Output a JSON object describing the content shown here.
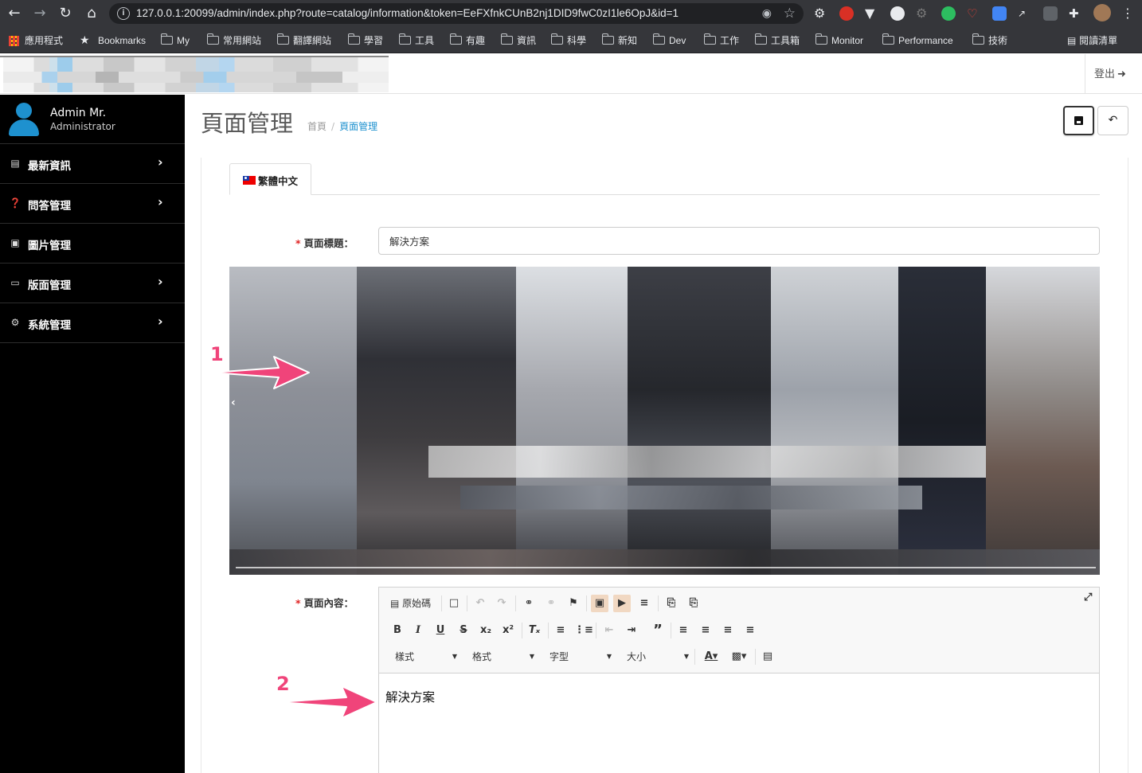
{
  "browser": {
    "url": "127.0.0.1:20099/admin/index.php?route=catalog/information&token=EeFXfnkCUnB2nj1DID9fwC0zI1le6OpJ&id=1",
    "bookmarks": [
      {
        "label": "應用程式",
        "icon": "apps-grid-icon"
      },
      {
        "label": "Bookmarks",
        "icon": "star-icon"
      },
      {
        "label": "My",
        "icon": "folder-icon"
      },
      {
        "label": "常用網站",
        "icon": "folder-icon"
      },
      {
        "label": "翻譯網站",
        "icon": "folder-icon"
      },
      {
        "label": "學習",
        "icon": "folder-icon"
      },
      {
        "label": "工具",
        "icon": "folder-icon"
      },
      {
        "label": "有趣",
        "icon": "folder-icon"
      },
      {
        "label": "資訊",
        "icon": "folder-icon"
      },
      {
        "label": "科學",
        "icon": "folder-icon"
      },
      {
        "label": "新知",
        "icon": "folder-icon"
      },
      {
        "label": "Dev",
        "icon": "folder-icon"
      },
      {
        "label": "工作",
        "icon": "folder-icon"
      },
      {
        "label": "工具箱",
        "icon": "folder-icon"
      },
      {
        "label": "Monitor",
        "icon": "folder-icon"
      },
      {
        "label": "Performance",
        "icon": "folder-icon"
      },
      {
        "label": "技術",
        "icon": "folder-icon"
      }
    ],
    "reading_list": "閱讀清單"
  },
  "header": {
    "logout_label": "登出"
  },
  "sidebar": {
    "user_name": "Admin Mr.",
    "user_role": "Administrator",
    "items": [
      {
        "label": "最新資訊",
        "icon": "newspaper-icon",
        "has_children": true
      },
      {
        "label": "問答管理",
        "icon": "question-circle-icon",
        "has_children": true
      },
      {
        "label": "圖片管理",
        "icon": "images-icon",
        "has_children": false
      },
      {
        "label": "版面管理",
        "icon": "desktop-icon",
        "has_children": true
      },
      {
        "label": "系統管理",
        "icon": "cog-icon",
        "has_children": true
      }
    ]
  },
  "main": {
    "title": "頁面管理",
    "breadcrumb": [
      "首頁",
      "頁面管理"
    ],
    "tab_language": "繁體中文",
    "field_title_label": "頁面標題：",
    "field_title_value": "解決方案",
    "field_content_label": "頁面內容：",
    "editor": {
      "source_label": "原始碼",
      "combos": [
        "樣式",
        "格式",
        "字型",
        "大小"
      ],
      "content_text": "解決方案"
    }
  },
  "annotations": [
    "1",
    "2"
  ],
  "colors": {
    "accent": "#1e91cf",
    "required": "#e02222",
    "annotation": "#f0447a",
    "sidebar_bg": "#000000"
  }
}
